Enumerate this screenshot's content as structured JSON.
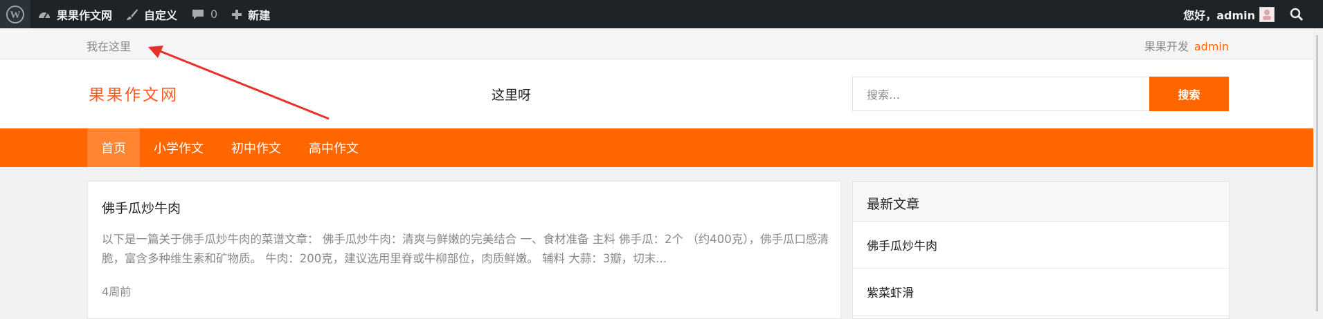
{
  "admin_bar": {
    "site_name": "果果作文网",
    "customize": "自定义",
    "comments_count": "0",
    "new_label": "新建",
    "greeting": "您好，admin"
  },
  "top_strip": {
    "location": "我在这里",
    "site_label": "果果开发",
    "user_link": "admin"
  },
  "header": {
    "logo_text": "果果作文网",
    "center_text": "这里呀",
    "search_placeholder": "搜索…",
    "search_button": "搜索"
  },
  "nav": {
    "items": [
      {
        "label": "首页"
      },
      {
        "label": "小学作文"
      },
      {
        "label": "初中作文"
      },
      {
        "label": "高中作文"
      }
    ]
  },
  "post": {
    "title": "佛手瓜炒牛肉",
    "excerpt": "以下是一篇关于佛手瓜炒牛肉的菜谱文章： 佛手瓜炒牛肉：清爽与鲜嫩的完美结合 一、食材准备 主料 佛手瓜：2个 （约400克），佛手瓜口感清脆，富含多种维生素和矿物质。 牛肉：200克，建议选用里脊或牛柳部位，肉质鲜嫩。 辅料 大蒜：3瓣，切末...",
    "date": "4周前"
  },
  "sidebar": {
    "heading": "最新文章",
    "items": [
      {
        "label": "佛手瓜炒牛肉"
      },
      {
        "label": "紫菜虾滑"
      }
    ]
  },
  "colors": {
    "accent": "#ff6600",
    "admin_bar": "#1d2327",
    "annotation_arrow": "#e8312a"
  }
}
